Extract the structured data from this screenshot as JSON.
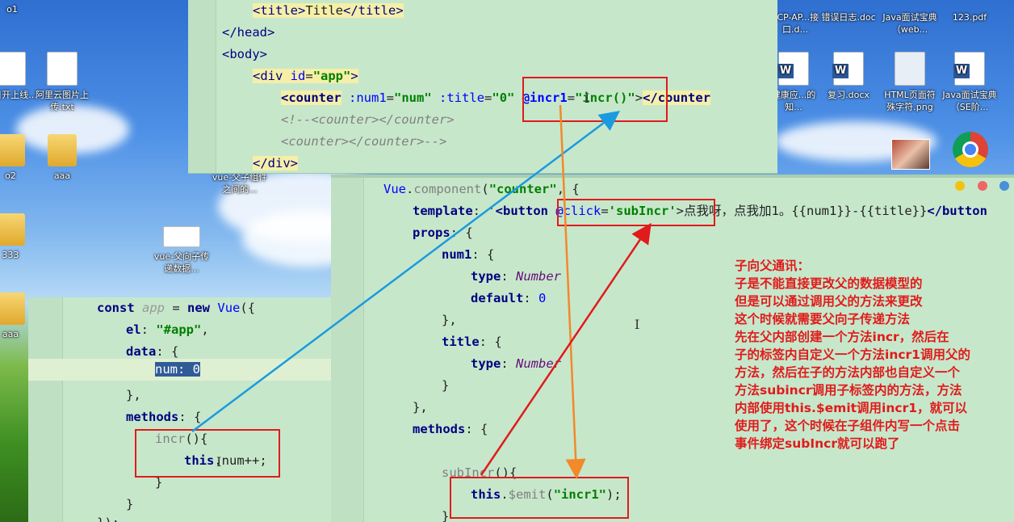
{
  "desktop": {
    "icons": [
      {
        "label": "o1",
        "type": "folder"
      },
      {
        "label": "项目开上线...",
        "type": "doc"
      },
      {
        "label": "阿里云图片上传.txt",
        "type": "doc"
      },
      {
        "label": "o2",
        "type": "folder"
      },
      {
        "label": "aaa",
        "type": "folder"
      },
      {
        "label": "vue-父子组件之间的...",
        "type": "doc"
      },
      {
        "label": "333",
        "type": "folder"
      },
      {
        "label": "vue-父向子传递数据...",
        "type": "doc"
      },
      {
        "label": "aaa",
        "type": "folder"
      },
      {
        "label": "PCP-AP...接口.d...",
        "type": "word"
      },
      {
        "label": "错误日志.doc",
        "type": "word"
      },
      {
        "label": "Java面试宝典（web...",
        "type": "word"
      },
      {
        "label": "123.pdf",
        "type": "doc"
      },
      {
        "label": "健康应...的知...",
        "type": "word"
      },
      {
        "label": "复习.docx",
        "type": "word"
      },
      {
        "label": "HTML页面符殊字符.png",
        "type": "image"
      },
      {
        "label": "Java面试宝典（SE阶...",
        "type": "word"
      }
    ]
  },
  "html_panel": {
    "lines": [
      "<title>Title</title>",
      "</head>",
      "<body>",
      "<div id=\"app\">",
      "<counter :num1=\"num\" :title=\"0\" @incr1=\"incr()\"></counter>",
      "<!--<counter></counter>",
      "<counter></counter>-->",
      "</div>"
    ]
  },
  "vue_panel": {
    "lines": [
      "Vue.component(\"counter\", {",
      "template: '<button @click='subIncr'>点我呀，点我加1。{{num1}}-{{title}}</button>",
      "props: {",
      "num1: {",
      "type: Number",
      "default: 0",
      "},",
      "title: {",
      "type: Number",
      "}",
      "},",
      "methods: {",
      "",
      "subIncr(){",
      "this.$emit(\"incr1\");",
      "}"
    ]
  },
  "app_panel": {
    "lines": [
      "const app = new Vue({",
      "el: \"#app\",",
      "data: {",
      "num: 0",
      "},",
      "methods: {",
      "incr(){",
      "this.num++;",
      "}",
      "}",
      "});"
    ]
  },
  "annotation": {
    "color": "#e01b1b",
    "lines": [
      "子向父通讯：",
      "子是不能直接更改父的数据模型的",
      "但是可以通过调用父的方法来更改",
      "这个时候就需要父向子传递方法",
      "先在父内部创建一个方法incr，然后在",
      "子的标签内自定义一个方法incr1调用父的",
      "方法，然后在子的方法内部也自定义一个",
      "方法subincr调用子标签内的方法，方法",
      "内部使用this.$emit调用incr1，就可以",
      "使用了，这个时候在子组件内写一个点击",
      "事件绑定subIncr就可以跑了"
    ]
  },
  "colors": {
    "editor_bg": "#c7e7cb",
    "arrow_blue": "#1a9be0",
    "arrow_orange": "#f2892a",
    "arrow_red": "#e01b1b"
  }
}
